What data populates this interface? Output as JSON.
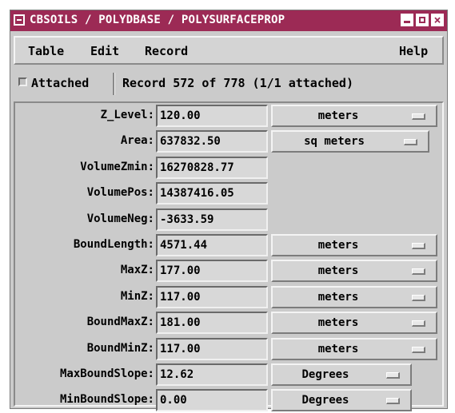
{
  "window": {
    "title": "CBSOILS / POLYDBASE / POLYSURFACEPROP",
    "close_glyph": "×",
    "colors": {
      "titlebar": "#9c2a55",
      "panel": "#cbcbcb",
      "field": "#d8d8d8"
    }
  },
  "menubar": {
    "table": "Table",
    "edit": "Edit",
    "record": "Record",
    "help": "Help"
  },
  "status": {
    "attached_label": "Attached",
    "attached_checked": false,
    "record_text": "Record 572 of 778 (1/1 attached)"
  },
  "fields": [
    {
      "label": "Z_Level:",
      "value": "120.00",
      "unit": "meters"
    },
    {
      "label": "Area:",
      "value": "637832.50",
      "unit": "sq meters"
    },
    {
      "label": "VolumeZmin:",
      "value": "16270828.77",
      "unit": ""
    },
    {
      "label": "VolumePos:",
      "value": "14387416.05",
      "unit": ""
    },
    {
      "label": "VolumeNeg:",
      "value": "-3633.59",
      "unit": ""
    },
    {
      "label": "BoundLength:",
      "value": "4571.44",
      "unit": "meters"
    },
    {
      "label": "MaxZ:",
      "value": "177.00",
      "unit": "meters"
    },
    {
      "label": "MinZ:",
      "value": "117.00",
      "unit": "meters"
    },
    {
      "label": "BoundMaxZ:",
      "value": "181.00",
      "unit": "meters"
    },
    {
      "label": "BoundMinZ:",
      "value": "117.00",
      "unit": "meters"
    },
    {
      "label": "MaxBoundSlope:",
      "value": "12.62",
      "unit": "Degrees"
    },
    {
      "label": "MinBoundSlope:",
      "value": "0.00",
      "unit": "Degrees"
    }
  ]
}
